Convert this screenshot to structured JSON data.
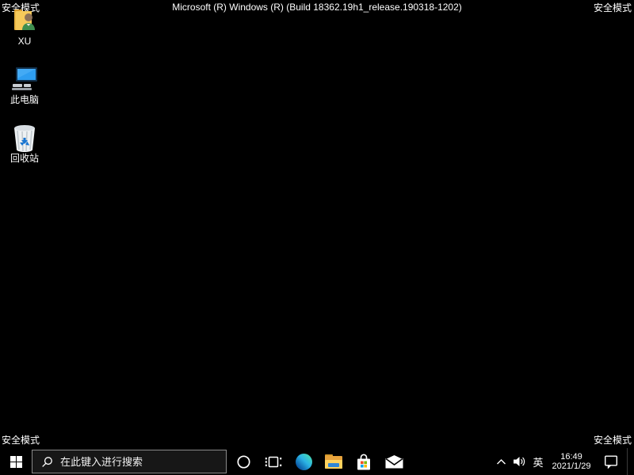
{
  "safe_mode": {
    "label": "安全模式"
  },
  "banner": {
    "text": "Microsoft (R) Windows (R) (Build 18362.19h1_release.190318-1202)"
  },
  "desktop": {
    "icons": [
      {
        "label": "XU",
        "icon": "user-folder-icon"
      },
      {
        "label": "此电脑",
        "icon": "this-pc-icon"
      },
      {
        "label": "回收站",
        "icon": "recycle-bin-icon"
      }
    ]
  },
  "taskbar": {
    "start": {
      "icon": "windows-logo-icon"
    },
    "search": {
      "placeholder": "在此键入进行搜索",
      "icon": "search-icon"
    },
    "buttons": [
      {
        "icon": "cortana-icon"
      },
      {
        "icon": "task-view-icon"
      },
      {
        "icon": "edge-icon"
      },
      {
        "icon": "file-explorer-icon"
      },
      {
        "icon": "store-icon"
      },
      {
        "icon": "mail-icon"
      }
    ],
    "tray": {
      "hidden_icons": {
        "icon": "chevron-up-icon"
      },
      "volume": {
        "icon": "speaker-icon"
      },
      "input_method": "英",
      "clock": {
        "time": "16:49",
        "date": "2021/1/29"
      },
      "action_center": {
        "icon": "action-center-icon"
      }
    }
  },
  "colors": {
    "desktop_bg": "#000000",
    "taskbar_bg": "#000000",
    "text": "#ffffff",
    "folder_yellow": "#ffd25e",
    "folder_amber": "#e8a33d",
    "edge_blue": "#0b59a5",
    "edge_green": "#4ee6a2",
    "monitor_blue": "#2196f3",
    "recycle_blue": "#1976d2",
    "store_red": "#f25022",
    "store_green": "#7fba00",
    "store_blue": "#00a4ef",
    "store_yellow": "#ffb900"
  }
}
